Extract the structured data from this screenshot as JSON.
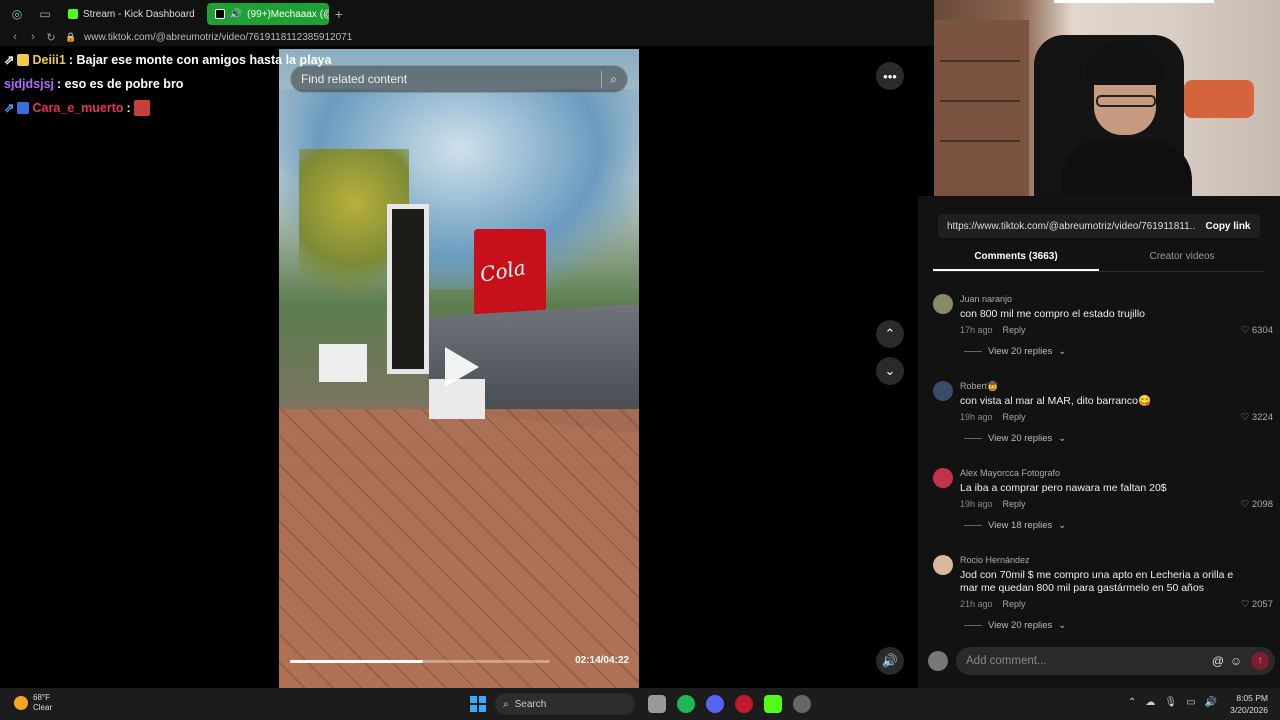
{
  "browser": {
    "tabs": [
      {
        "label": "Stream - Kick Dashboard"
      },
      {
        "label": "(99+)Mechaaax (@me"
      }
    ],
    "new_tab": "+",
    "url": "www.tiktok.com/@abreumotriz/video/7619118112385912071"
  },
  "chat": [
    {
      "user": "Deiii1",
      "text": ": Bajar ese monte con amigos hasta la playa"
    },
    {
      "user": "sjdjdsjsj",
      "text": ": eso es de pobre bro"
    },
    {
      "user": "Cara_e_muerto",
      "text": ":"
    }
  ],
  "video": {
    "search_placeholder": "Find related content",
    "fridge_text": "Cola",
    "time": "02:14/04:22",
    "progress": 0.51
  },
  "panel": {
    "share_url": "https://www.tiktok.com/@abreumotriz/video/761911811...",
    "copy_label": "Copy link",
    "tabs": [
      "Comments (3663)",
      "Creator videos"
    ],
    "comments": [
      {
        "name": "Juan naranjo",
        "body": "con 800 mil me compro el estado trujillo",
        "time": "17h ago",
        "reply": "Reply",
        "likes": "6304",
        "replies": "View 20 replies",
        "avatar_color": "#8a8a6a"
      },
      {
        "name": "Robert🤠",
        "body": "con vista al mar al MAR, dito barranco😋",
        "time": "19h ago",
        "reply": "Reply",
        "likes": "3224",
        "replies": "View 20 replies",
        "avatar_color": "#3a4a6a"
      },
      {
        "name": "Alex Mayorcca Fotografo",
        "body": "La iba a comprar pero nawara me faltan 20$",
        "time": "19h ago",
        "reply": "Reply",
        "likes": "2098",
        "replies": "View 18 replies",
        "avatar_color": "#c2334a"
      },
      {
        "name": "Rocio Hernández",
        "body": "Jod con 70mil $ me compro una apto en Lecheria a orilla e mar me quedan 800 mil para gastármelo en 50 años",
        "time": "21h ago",
        "reply": "Reply",
        "likes": "2057",
        "replies": "View 20 replies",
        "avatar_color": "#d9b99a"
      }
    ],
    "add_comment_placeholder": "Add comment..."
  },
  "taskbar": {
    "temp": "68°F",
    "condition": "Clear",
    "search": "Search",
    "time": "8:05 PM",
    "date": "3/20/2026"
  },
  "colors": {
    "kick_green": "#53fc18",
    "tab_active": "#1fa035",
    "tiktok_send": "#7a1f2d"
  }
}
